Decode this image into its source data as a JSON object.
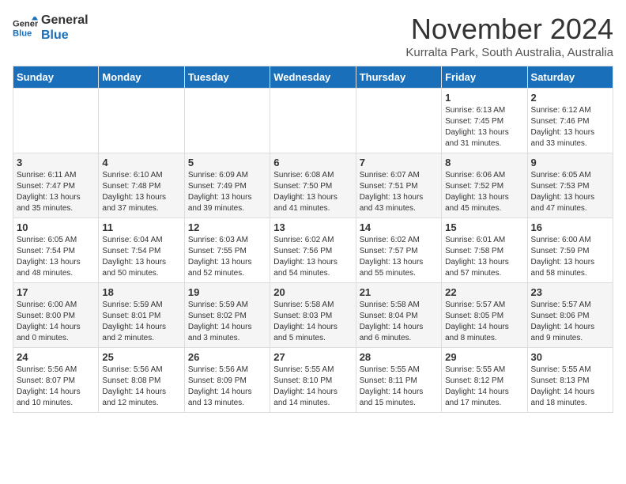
{
  "header": {
    "logo_line1": "General",
    "logo_line2": "Blue",
    "month": "November 2024",
    "location": "Kurralta Park, South Australia, Australia"
  },
  "weekdays": [
    "Sunday",
    "Monday",
    "Tuesday",
    "Wednesday",
    "Thursday",
    "Friday",
    "Saturday"
  ],
  "weeks": [
    [
      {
        "day": "",
        "info": ""
      },
      {
        "day": "",
        "info": ""
      },
      {
        "day": "",
        "info": ""
      },
      {
        "day": "",
        "info": ""
      },
      {
        "day": "",
        "info": ""
      },
      {
        "day": "1",
        "info": "Sunrise: 6:13 AM\nSunset: 7:45 PM\nDaylight: 13 hours and 31 minutes."
      },
      {
        "day": "2",
        "info": "Sunrise: 6:12 AM\nSunset: 7:46 PM\nDaylight: 13 hours and 33 minutes."
      }
    ],
    [
      {
        "day": "3",
        "info": "Sunrise: 6:11 AM\nSunset: 7:47 PM\nDaylight: 13 hours and 35 minutes."
      },
      {
        "day": "4",
        "info": "Sunrise: 6:10 AM\nSunset: 7:48 PM\nDaylight: 13 hours and 37 minutes."
      },
      {
        "day": "5",
        "info": "Sunrise: 6:09 AM\nSunset: 7:49 PM\nDaylight: 13 hours and 39 minutes."
      },
      {
        "day": "6",
        "info": "Sunrise: 6:08 AM\nSunset: 7:50 PM\nDaylight: 13 hours and 41 minutes."
      },
      {
        "day": "7",
        "info": "Sunrise: 6:07 AM\nSunset: 7:51 PM\nDaylight: 13 hours and 43 minutes."
      },
      {
        "day": "8",
        "info": "Sunrise: 6:06 AM\nSunset: 7:52 PM\nDaylight: 13 hours and 45 minutes."
      },
      {
        "day": "9",
        "info": "Sunrise: 6:05 AM\nSunset: 7:53 PM\nDaylight: 13 hours and 47 minutes."
      }
    ],
    [
      {
        "day": "10",
        "info": "Sunrise: 6:05 AM\nSunset: 7:54 PM\nDaylight: 13 hours and 48 minutes."
      },
      {
        "day": "11",
        "info": "Sunrise: 6:04 AM\nSunset: 7:54 PM\nDaylight: 13 hours and 50 minutes."
      },
      {
        "day": "12",
        "info": "Sunrise: 6:03 AM\nSunset: 7:55 PM\nDaylight: 13 hours and 52 minutes."
      },
      {
        "day": "13",
        "info": "Sunrise: 6:02 AM\nSunset: 7:56 PM\nDaylight: 13 hours and 54 minutes."
      },
      {
        "day": "14",
        "info": "Sunrise: 6:02 AM\nSunset: 7:57 PM\nDaylight: 13 hours and 55 minutes."
      },
      {
        "day": "15",
        "info": "Sunrise: 6:01 AM\nSunset: 7:58 PM\nDaylight: 13 hours and 57 minutes."
      },
      {
        "day": "16",
        "info": "Sunrise: 6:00 AM\nSunset: 7:59 PM\nDaylight: 13 hours and 58 minutes."
      }
    ],
    [
      {
        "day": "17",
        "info": "Sunrise: 6:00 AM\nSunset: 8:00 PM\nDaylight: 14 hours and 0 minutes."
      },
      {
        "day": "18",
        "info": "Sunrise: 5:59 AM\nSunset: 8:01 PM\nDaylight: 14 hours and 2 minutes."
      },
      {
        "day": "19",
        "info": "Sunrise: 5:59 AM\nSunset: 8:02 PM\nDaylight: 14 hours and 3 minutes."
      },
      {
        "day": "20",
        "info": "Sunrise: 5:58 AM\nSunset: 8:03 PM\nDaylight: 14 hours and 5 minutes."
      },
      {
        "day": "21",
        "info": "Sunrise: 5:58 AM\nSunset: 8:04 PM\nDaylight: 14 hours and 6 minutes."
      },
      {
        "day": "22",
        "info": "Sunrise: 5:57 AM\nSunset: 8:05 PM\nDaylight: 14 hours and 8 minutes."
      },
      {
        "day": "23",
        "info": "Sunrise: 5:57 AM\nSunset: 8:06 PM\nDaylight: 14 hours and 9 minutes."
      }
    ],
    [
      {
        "day": "24",
        "info": "Sunrise: 5:56 AM\nSunset: 8:07 PM\nDaylight: 14 hours and 10 minutes."
      },
      {
        "day": "25",
        "info": "Sunrise: 5:56 AM\nSunset: 8:08 PM\nDaylight: 14 hours and 12 minutes."
      },
      {
        "day": "26",
        "info": "Sunrise: 5:56 AM\nSunset: 8:09 PM\nDaylight: 14 hours and 13 minutes."
      },
      {
        "day": "27",
        "info": "Sunrise: 5:55 AM\nSunset: 8:10 PM\nDaylight: 14 hours and 14 minutes."
      },
      {
        "day": "28",
        "info": "Sunrise: 5:55 AM\nSunset: 8:11 PM\nDaylight: 14 hours and 15 minutes."
      },
      {
        "day": "29",
        "info": "Sunrise: 5:55 AM\nSunset: 8:12 PM\nDaylight: 14 hours and 17 minutes."
      },
      {
        "day": "30",
        "info": "Sunrise: 5:55 AM\nSunset: 8:13 PM\nDaylight: 14 hours and 18 minutes."
      }
    ]
  ]
}
